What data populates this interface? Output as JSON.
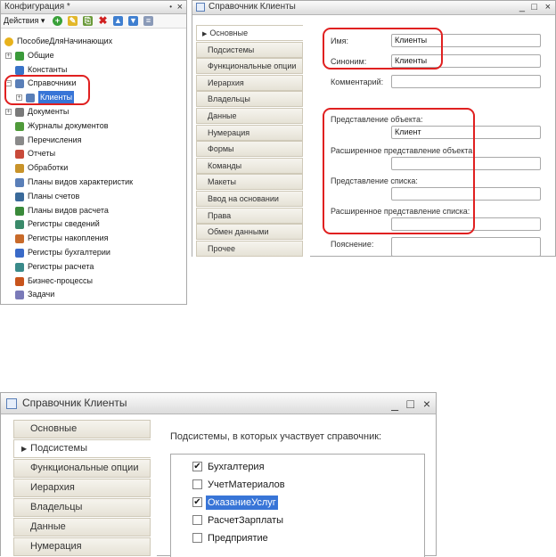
{
  "config_panel": {
    "title": "Конфигурация *",
    "pin_glyph": "!",
    "close_glyph": "×",
    "actions_label": "Действия ▾",
    "toolbar_icons": [
      "add-icon",
      "edit-icon",
      "copy-icon",
      "delete-icon",
      "move-up-icon",
      "move-down-icon",
      "list-icon"
    ],
    "tree": [
      {
        "label": "ПособиеДляНачинающих",
        "icon": "config-root-icon",
        "icon_color": "#e8b21c"
      },
      {
        "label": "Общие",
        "icon": "common-icon",
        "icon_color": "#3a9a3a",
        "expander": "+"
      },
      {
        "label": "Константы",
        "icon": "constants-icon",
        "icon_color": "#3973c8"
      },
      {
        "label": "Справочники",
        "icon": "catalogs-icon",
        "icon_color": "#5a7fb8",
        "expander": "−"
      },
      {
        "label": "Клиенты",
        "icon": "catalog-icon",
        "icon_color": "#5a7fb8",
        "expander": "+",
        "selected": true
      },
      {
        "label": "Документы",
        "icon": "documents-icon",
        "icon_color": "#7a7a7a",
        "expander": "+"
      },
      {
        "label": "Журналы документов",
        "icon": "journals-icon",
        "icon_color": "#4f9a3a"
      },
      {
        "label": "Перечисления",
        "icon": "enums-icon",
        "icon_color": "#8a8a8a"
      },
      {
        "label": "Отчеты",
        "icon": "reports-icon",
        "icon_color": "#c84a3a"
      },
      {
        "label": "Обработки",
        "icon": "processing-icon",
        "icon_color": "#c8932a"
      },
      {
        "label": "Планы видов характеристик",
        "icon": "chart-char-icon",
        "icon_color": "#5a7fb8"
      },
      {
        "label": "Планы счетов",
        "icon": "chart-accounts-icon",
        "icon_color": "#3a6a9a"
      },
      {
        "label": "Планы видов расчета",
        "icon": "chart-calc-icon",
        "icon_color": "#3a8a3a"
      },
      {
        "label": "Регистры сведений",
        "icon": "info-registers-icon",
        "icon_color": "#3a8a6a"
      },
      {
        "label": "Регистры накопления",
        "icon": "accum-registers-icon",
        "icon_color": "#c86a2a"
      },
      {
        "label": "Регистры бухгалтерии",
        "icon": "acc-registers-icon",
        "icon_color": "#3a6ac8"
      },
      {
        "label": "Регистры расчета",
        "icon": "calc-registers-icon",
        "icon_color": "#3a8a8a"
      },
      {
        "label": "Бизнес-процессы",
        "icon": "business-process-icon",
        "icon_color": "#c8541c"
      },
      {
        "label": "Задачи",
        "icon": "tasks-icon",
        "icon_color": "#7a7ab8"
      }
    ]
  },
  "window1": {
    "title": "Справочник Клиенты",
    "controls": [
      "_",
      "□",
      "×"
    ],
    "tabs": [
      "Основные",
      "Подсистемы",
      "Функциональные опции",
      "Иерархия",
      "Владельцы",
      "Данные",
      "Нумерация",
      "Формы",
      "Команды",
      "Макеты",
      "Ввод на основании",
      "Права",
      "Обмен данными",
      "Прочее"
    ],
    "active_tab_marker": "▶",
    "name_label": "Имя:",
    "name_value": "Клиенты",
    "synonym_label": "Синоним:",
    "synonym_value": "Клиенты",
    "comment_label": "Комментарий:",
    "comment_value": "",
    "object_repr_label": "Представление объекта:",
    "object_repr_value": "Клиент",
    "ext_object_repr_label": "Расширенное представление объекта:",
    "ext_object_repr_value": "",
    "list_repr_label": "Представление списка:",
    "list_repr_value": "",
    "ext_list_repr_label": "Расширенное представление списка:",
    "ext_list_repr_value": "",
    "explanation_label": "Пояснение:",
    "explanation_value": "",
    "highlight_color": "#e02020"
  },
  "window2": {
    "title": "Справочник Клиенты",
    "controls": [
      "_",
      "□",
      "×"
    ],
    "tabs": [
      "Основные",
      "Подсистемы",
      "Функциональные опции",
      "Иерархия",
      "Владельцы",
      "Данные",
      "Нумерация"
    ],
    "active_tab_marker": "▶",
    "subsystems_caption": "Подсистемы, в которых участвует справочник:",
    "subsystems": [
      {
        "label": "Бухгалтерия",
        "checked": true
      },
      {
        "label": "УчетМатериалов",
        "checked": false
      },
      {
        "label": "ОказаниеУслуг",
        "checked": true,
        "selected": true
      },
      {
        "label": "РасчетЗарплаты",
        "checked": false
      },
      {
        "label": "Предприятие",
        "checked": false
      }
    ],
    "check_glyph": "✔",
    "selection_color": "#3875d7"
  }
}
